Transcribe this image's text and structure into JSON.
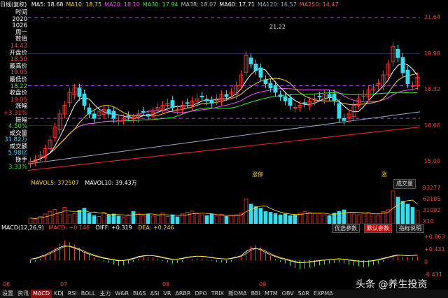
{
  "topbar": {
    "title": "日线(复权)",
    "ma": [
      {
        "label": "MA5: 18.68",
        "color": "#ffffff"
      },
      {
        "label": "MA10: 18.75",
        "color": "#ffd700"
      },
      {
        "label": "MA20: 18.10",
        "color": "#ff44ff"
      },
      {
        "label": "MA30: 17.94",
        "color": "#33ee33"
      },
      {
        "label": "MA38: 18.07",
        "color": "#bbbbbb"
      },
      {
        "label": "MA60: 17.71",
        "color": "#ffffff"
      },
      {
        "label": "MA120: 16.57",
        "color": "#99aacc"
      },
      {
        "label": "MA250: 14.47",
        "color": "#ff5555"
      }
    ]
  },
  "left_panel": [
    {
      "text": "时间",
      "color": "#ffffff"
    },
    {
      "text": "2020",
      "color": "#ffffff"
    },
    {
      "text": "1026",
      "color": "#ffffff"
    },
    {
      "text": "周一",
      "color": "#ffffff"
    },
    {
      "text": "数值",
      "color": "#ffffff"
    },
    {
      "text": "14.43",
      "color": "#ff4040"
    },
    {
      "text": "开盘价",
      "color": "#ffffff"
    },
    {
      "text": "18.50",
      "color": "#ff4040"
    },
    {
      "text": "最高价",
      "color": "#ffffff"
    },
    {
      "text": "19.05",
      "color": "#ff4040"
    },
    {
      "text": "最低价",
      "color": "#ffffff"
    },
    {
      "text": "18.22",
      "color": "#33ee33"
    },
    {
      "text": "收盘价",
      "color": "#ffffff"
    },
    {
      "text": "19.05",
      "color": "#ff4040"
    },
    {
      "text": "涨幅",
      "color": "#ffffff"
    },
    {
      "text": "+3.31%",
      "color": "#ff4040"
    },
    {
      "text": "振幅",
      "color": "#ffffff"
    },
    {
      "text": "4.50%",
      "color": "#33ee33"
    },
    {
      "text": "成交量",
      "color": "#ffffff"
    },
    {
      "text": "31.82万",
      "color": "#33ddff"
    },
    {
      "text": "成交额",
      "color": "#ffffff"
    },
    {
      "text": "5.98亿",
      "color": "#33ddff"
    },
    {
      "text": "换手",
      "color": "#ffffff"
    },
    {
      "text": "3.33%",
      "color": "#33ee33"
    }
  ],
  "price_axis": {
    "labels": [
      "21.64",
      "19.98",
      "18.32",
      "16.66",
      "15.00"
    ],
    "min": 14.2,
    "max": 22.0
  },
  "annotations": {
    "peak": "21.22",
    "news1": "涨停",
    "news2": "涨"
  },
  "volume": {
    "mavol5": "MAVOL5: 372507",
    "mavol10": "MAVOL10: 39.43万",
    "label": "成交量",
    "axis": [
      "93277",
      "62185",
      "31092",
      "X10"
    ],
    "values": [
      14,
      12,
      18,
      24,
      30,
      35,
      28,
      40,
      22,
      25,
      33,
      38,
      26,
      20,
      18,
      28,
      22,
      24,
      19,
      17,
      22,
      30,
      26,
      20,
      24,
      19,
      21,
      27,
      18,
      22,
      17,
      24,
      28,
      31,
      26,
      22,
      20,
      24,
      19,
      23,
      18,
      20,
      22,
      26,
      60,
      48,
      42,
      38,
      30,
      28,
      25,
      22,
      24,
      20,
      22,
      26,
      30,
      28,
      25,
      24,
      22,
      20,
      26,
      30,
      34,
      28,
      24,
      22,
      26,
      28,
      24,
      22,
      30,
      34,
      80,
      65,
      55,
      48,
      40,
      32
    ]
  },
  "macd": {
    "label": "MACD(12,26,9)",
    "macd_value": "MACD: +0.146",
    "diff": "DIFF: +0.319",
    "dea": "DEA: +0.246",
    "axis": [
      "+0.863",
      "+0.431",
      "0",
      "-0.431"
    ],
    "buttons": [
      "优选参数",
      "默认参数",
      "指标说明"
    ],
    "values": [
      -0.1,
      -0.05,
      0.05,
      0.15,
      0.3,
      0.45,
      0.6,
      0.7,
      0.65,
      0.55,
      0.45,
      0.3,
      0.2,
      0.1,
      0.02,
      -0.05,
      -0.1,
      -0.15,
      -0.2,
      -0.18,
      -0.12,
      -0.05,
      0.05,
      0.1,
      0.12,
      0.1,
      0.05,
      -0.02,
      -0.08,
      -0.12,
      -0.1,
      -0.05,
      0.02,
      0.05,
      0.08,
      0.06,
      0.03,
      -0.02,
      -0.06,
      -0.08,
      -0.1,
      -0.05,
      0.02,
      0.1,
      0.35,
      0.5,
      0.55,
      0.45,
      0.3,
      0.15,
      0.05,
      -0.05,
      -0.12,
      -0.2,
      -0.28,
      -0.32,
      -0.3,
      -0.26,
      -0.22,
      -0.18,
      -0.15,
      -0.12,
      -0.1,
      -0.08,
      -0.12,
      -0.16,
      -0.2,
      -0.22,
      -0.25,
      -0.22,
      -0.18,
      -0.12,
      -0.05,
      0.02,
      0.1,
      0.15,
      0.12,
      0.1,
      0.12,
      0.14
    ]
  },
  "x_axis": [
    "06",
    "07",
    "08",
    "09"
  ],
  "tabs": [
    "设置",
    "资讯",
    "MACD",
    "KDJ",
    "RSI",
    "BOLL",
    "主力",
    "W&R",
    "BIAS",
    "ASI",
    "VR",
    "ARBR",
    "DPO",
    "TRIX",
    "新DMA",
    "BBI",
    "MTM",
    "OBV",
    "SAR",
    "EXPMA"
  ],
  "active_tab": "MACD",
  "watermark": "头条 @养生投资",
  "colors": {
    "up": "#ff3030",
    "down": "#33ddee",
    "ma_yellow": "#ffd700",
    "ma_magenta": "#ff44ff",
    "ma_green": "#33ee33",
    "ma_red": "#dd2222",
    "dash": "#b040ff"
  }
}
